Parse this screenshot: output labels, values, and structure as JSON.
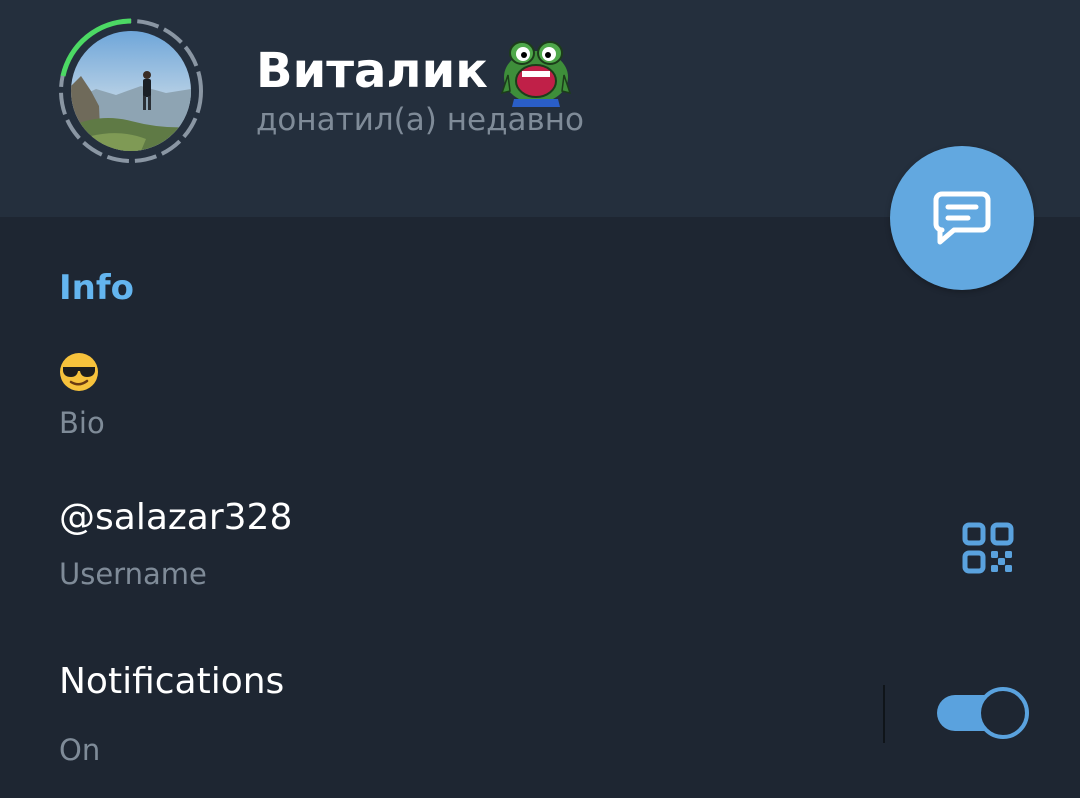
{
  "header": {
    "name": "Виталик",
    "status": "донатил(а) недавно"
  },
  "info": {
    "section_title": "Info",
    "bio_value": "😎",
    "bio_label": "Bio",
    "username_value": "@salazar328",
    "username_label": "Username",
    "notifications_title": "Notifications",
    "notifications_value": "On"
  },
  "colors": {
    "header_bg": "#242f3d",
    "body_bg": "#1e2632",
    "accent": "#62a8e0",
    "section_title": "#64b5ef",
    "muted_text": "#7f8b98",
    "story_ring_active": "#4cd964",
    "story_ring_inactive": "#8a96a3"
  },
  "icons": {
    "fab": "message-icon",
    "username_action": "qr-code-icon",
    "name_badge": "frog-emoji-status-icon",
    "bio_emoji": "sunglasses-emoji-icon"
  },
  "notifications_toggle": {
    "on": true
  }
}
